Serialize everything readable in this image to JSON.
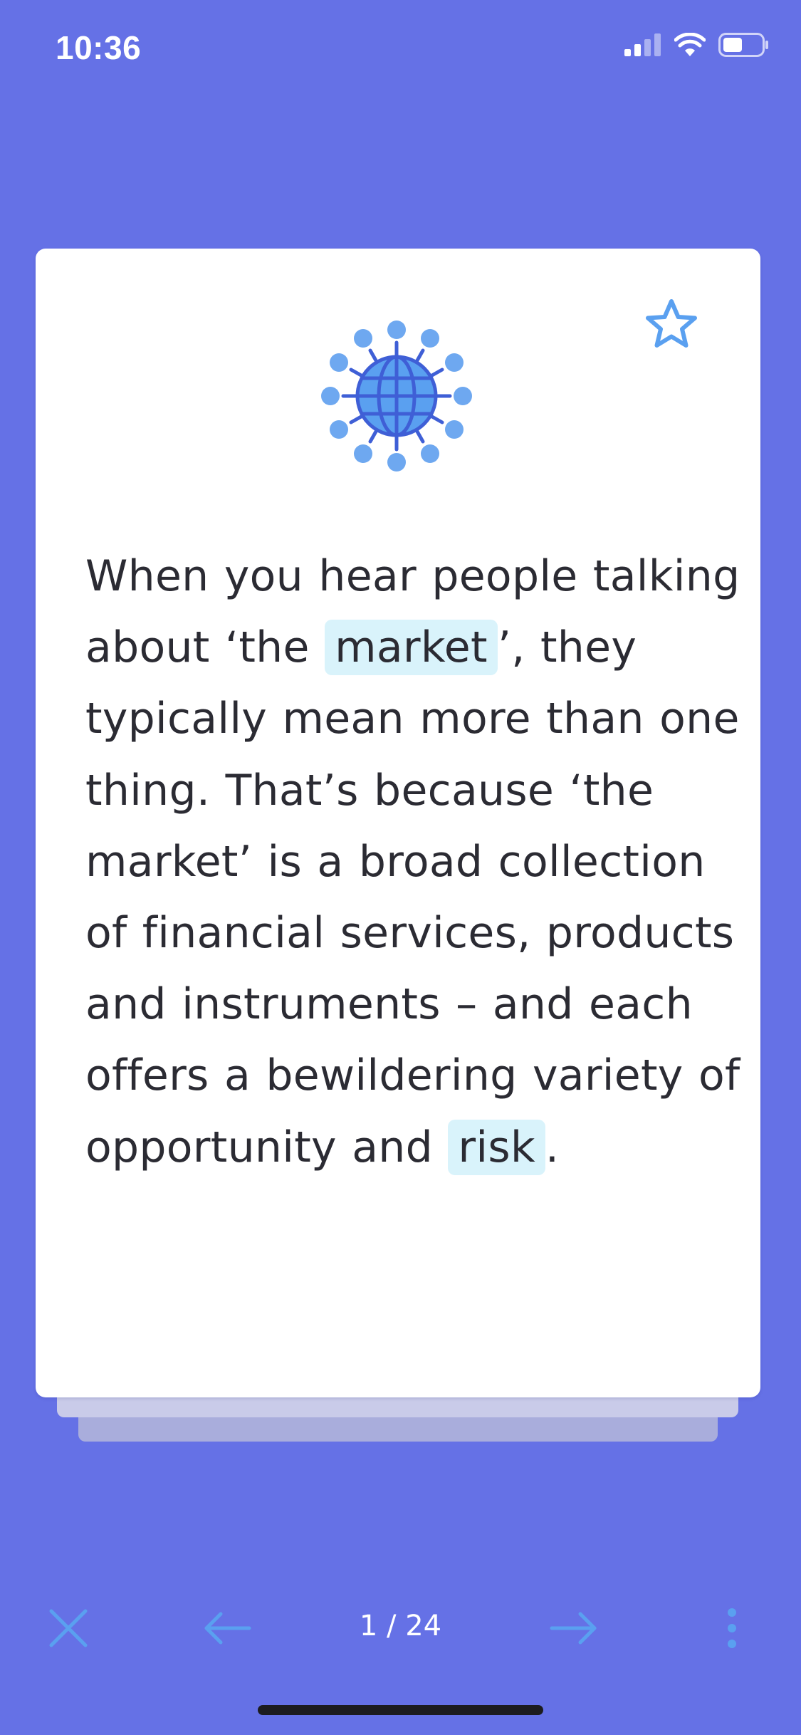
{
  "status_bar": {
    "time": "10:36"
  },
  "card": {
    "text_before_market": "When you hear people talking about ‘the ",
    "term_market": "market",
    "text_between": "’, they typically mean more than one thing. That’s because ‘the market’ is a broad collection of financial services, products and instruments – and each offers a bewildering variety of opportunity and ",
    "term_risk": "risk",
    "text_after": ".",
    "illustration_icon": "globe-network-icon",
    "bookmark_icon": "star-outline-icon"
  },
  "navigation": {
    "page_counter": "1 / 24",
    "close_icon": "close-icon",
    "prev_icon": "arrow-left-icon",
    "next_icon": "arrow-right-icon",
    "more_icon": "more-vertical-icon"
  },
  "colors": {
    "background": "#6571e6",
    "card": "#ffffff",
    "term_highlight": "#d9f3fb",
    "icon_accent": "#5aa0f0",
    "globe_dark": "#3f5fd6"
  }
}
